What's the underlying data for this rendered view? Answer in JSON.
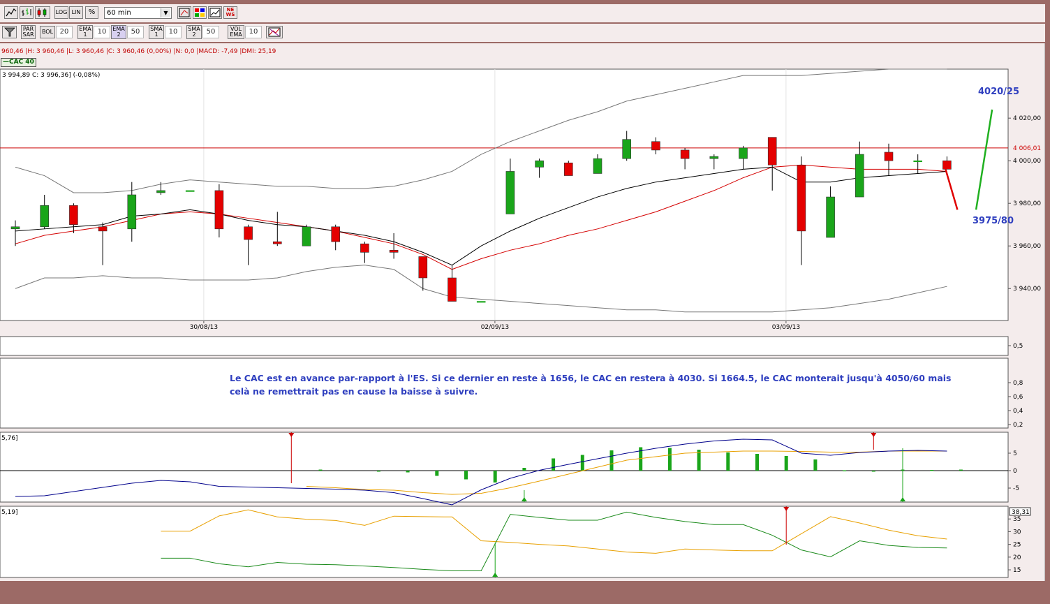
{
  "toolbar1": {
    "items": [
      {
        "name": "line-chart-icon",
        "glyph": "╱"
      },
      {
        "name": "bar-chart-icon",
        "glyph": "┃"
      },
      {
        "name": "candlestick-icon",
        "glyph": "▮"
      },
      {
        "name": "log-button",
        "label": "LOG"
      },
      {
        "name": "lin-button",
        "label": "LIN"
      },
      {
        "name": "percent-button",
        "label": "%"
      }
    ],
    "period_value": "60 min",
    "tool_icons": [
      "draw-tool-icon",
      "color-grid-icon",
      "compare-icon",
      "news-icon"
    ],
    "news_label": "NE WS"
  },
  "toolbar2": {
    "par_sar": "PAR SAR",
    "bol": "BOL",
    "bol_value": "20",
    "ema1": "EMA 1",
    "ema1_value": "10",
    "ema2": "EMA 2",
    "ema2_value": "50",
    "sma1": "SMA 1",
    "sma1_value": "10",
    "sma2": "SMA 2",
    "sma2_value": "50",
    "vol": "VOL EMA",
    "vol_value": "10"
  },
  "info_line": "960,46 |H: 3 960,46 |L: 3 960,46 |C: 3 960,46 (0,00%) |N: 0,0 |MACD: -7,49 |DMI: 25,19",
  "series_tag": "CAC 40",
  "price_line": "3 994,89  C: 3 996,36] (-0,08%)",
  "colors": {
    "bull": "#1aa51a",
    "bear": "#e40000",
    "ema_red": "#d40000",
    "sma_black": "#000000",
    "band": "#777777",
    "annotation": "#2f3fbf",
    "ref_line": "#cc0000",
    "macd": "#00008b",
    "signal": "#e8a000",
    "adx_green": "#1a8a1a",
    "adx_orange": "#e8a000",
    "marker": "#cc0000",
    "up_marker": "#1aa51a"
  },
  "annotation_text": "Le CAC est en avance par-rapport à l'ES. Si ce dernier en reste à 1656, le CAC en restera à 4030.  Si 1664.5, le CAC monterait jusqu'à 4050/60 mais celà ne remettrait pas en cause la baisse à suivre.",
  "chart_data": [
    {
      "type": "candlestick",
      "name": "CAC 40",
      "x_labels": [
        "30/08/13",
        "02/09/13",
        "03/09/13"
      ],
      "x_label_index": [
        7,
        17,
        27
      ],
      "ylim": [
        3925,
        4043
      ],
      "yticks": [
        {
          "v": 4020,
          "label": "4 020,00"
        },
        {
          "v": 4000,
          "label": "4 000,00"
        },
        {
          "v": 3980,
          "label": "3 980,00"
        },
        {
          "v": 3960,
          "label": "3 960,00"
        },
        {
          "v": 3940,
          "label": "3 940,00"
        }
      ],
      "ref_line": {
        "value": 4006.01,
        "label": "4 006,01"
      },
      "candles": [
        {
          "o": 3968,
          "h": 3972,
          "l": 3960,
          "c": 3969
        },
        {
          "o": 3969,
          "h": 3984,
          "l": 3968,
          "c": 3979
        },
        {
          "o": 3979,
          "h": 3980,
          "l": 3966,
          "c": 3970
        },
        {
          "o": 3969,
          "h": 3971,
          "l": 3951,
          "c": 3967
        },
        {
          "o": 3968,
          "h": 3990,
          "l": 3962,
          "c": 3984
        },
        {
          "o": 3985,
          "h": 3990,
          "l": 3984,
          "c": 3986
        },
        {
          "o": 3986,
          "h": 3986,
          "l": 3986,
          "c": 3986
        },
        {
          "o": 3986,
          "h": 3989,
          "l": 3964,
          "c": 3968
        },
        {
          "o": 3969,
          "h": 3970,
          "l": 3951,
          "c": 3963
        },
        {
          "o": 3962,
          "h": 3976,
          "l": 3960,
          "c": 3961
        },
        {
          "o": 3960,
          "h": 3970,
          "l": 3960,
          "c": 3969
        },
        {
          "o": 3969,
          "h": 3970,
          "l": 3958,
          "c": 3962
        },
        {
          "o": 3961,
          "h": 3962,
          "l": 3952,
          "c": 3957
        },
        {
          "o": 3958,
          "h": 3966,
          "l": 3954,
          "c": 3957
        },
        {
          "o": 3955,
          "h": 3955,
          "l": 3939,
          "c": 3945
        },
        {
          "o": 3945,
          "h": 3951,
          "l": 3934,
          "c": 3934
        },
        {
          "o": 3934,
          "h": 3934,
          "l": 3934,
          "c": 3934
        },
        {
          "o": 3975,
          "h": 4001,
          "l": 3975,
          "c": 3995
        },
        {
          "o": 3997,
          "h": 4001,
          "l": 3992,
          "c": 4000
        },
        {
          "o": 3999,
          "h": 4000,
          "l": 3993,
          "c": 3993
        },
        {
          "o": 3994,
          "h": 4003,
          "l": 3994,
          "c": 4001
        },
        {
          "o": 4001,
          "h": 4014,
          "l": 4000,
          "c": 4010
        },
        {
          "o": 4009,
          "h": 4011,
          "l": 4003,
          "c": 4005
        },
        {
          "o": 4005,
          "h": 4006,
          "l": 3996,
          "c": 4001
        },
        {
          "o": 4001,
          "h": 4003,
          "l": 3996,
          "c": 4002
        },
        {
          "o": 4001,
          "h": 4007,
          "l": 3996,
          "c": 4006
        },
        {
          "o": 4011,
          "h": 4011,
          "l": 3986,
          "c": 3998
        },
        {
          "o": 3998,
          "h": 4002,
          "l": 3951,
          "c": 3967
        },
        {
          "o": 3964,
          "h": 3988,
          "l": 3964,
          "c": 3983
        },
        {
          "o": 3983,
          "h": 4009,
          "l": 3983,
          "c": 4003
        },
        {
          "o": 4004,
          "h": 4008,
          "l": 3993,
          "c": 4000
        },
        {
          "o": 4000,
          "h": 4003,
          "l": 3994,
          "c": 4000
        },
        {
          "o": 4000,
          "h": 4002,
          "l": 3996,
          "c": 3996
        }
      ],
      "ema_red": [
        3961,
        3965,
        3967,
        3969,
        3972,
        3975,
        3976,
        3975,
        3973,
        3971,
        3969,
        3967,
        3964,
        3961,
        3956,
        3949,
        3954,
        3958,
        3961,
        3965,
        3968,
        3972,
        3976,
        3981,
        3986,
        3992,
        3997,
        3998,
        3997,
        3996,
        3996,
        3996,
        3995
      ],
      "sma_black": [
        3967,
        3968,
        3969,
        3970,
        3974,
        3975,
        3977,
        3975,
        3972,
        3970,
        3969,
        3967,
        3965,
        3962,
        3957,
        3951,
        3960,
        3967,
        3973,
        3978,
        3983,
        3987,
        3990,
        3992,
        3994,
        3996,
        3997,
        3990,
        3990,
        3992,
        3993,
        3994,
        3995
      ],
      "band_upper": [
        3997,
        3993,
        3985,
        3985,
        3986,
        3989,
        3991,
        3990,
        3989,
        3988,
        3988,
        3987,
        3987,
        3988,
        3991,
        3995,
        4003,
        4009,
        4014,
        4019,
        4023,
        4028,
        4031,
        4034,
        4037,
        4040,
        4040,
        4040,
        4041,
        4042,
        4043,
        4043,
        4043
      ],
      "band_lower": [
        3940,
        3945,
        3945,
        3946,
        3945,
        3945,
        3944,
        3944,
        3944,
        3945,
        3948,
        3950,
        3951,
        3949,
        3940,
        3936,
        3935,
        3934,
        3933,
        3932,
        3931,
        3930,
        3930,
        3929,
        3929,
        3929,
        3929,
        3930,
        3931,
        3933,
        3935,
        3938,
        3941
      ],
      "projection": [
        {
          "index": 32,
          "value": 3996,
          "type": "down",
          "to_value": 3977
        },
        {
          "index": 33,
          "value": 3977,
          "type": "up",
          "to_value": 4024
        }
      ],
      "labels": [
        {
          "text": "4020/25",
          "at": "top-right"
        },
        {
          "text": "3975/80",
          "at": "right"
        }
      ]
    },
    {
      "type": "line",
      "name": "oscillator",
      "ylim": [
        0,
        1
      ],
      "yticks": [
        {
          "v": 0.8,
          "label": "0,8"
        },
        {
          "v": 0.6,
          "label": "0,6"
        },
        {
          "v": 0.4,
          "label": "0,4"
        },
        {
          "v": 0.2,
          "label": "0,2"
        }
      ],
      "top_ticks": [
        {
          "v": 0.5,
          "label": "0,5"
        }
      ]
    },
    {
      "type": "bar",
      "name": "MACD",
      "header": "5,76]",
      "ylim": [
        -10,
        10
      ],
      "yticks": [
        {
          "v": 5,
          "label": "5"
        },
        {
          "v": 0,
          "label": "0"
        },
        {
          "v": -5,
          "label": "-5"
        }
      ],
      "histogram": [
        null,
        null,
        null,
        null,
        null,
        null,
        null,
        null,
        null,
        null,
        0.3,
        null,
        -0.1,
        -0.5,
        -1.5,
        -2.5,
        -3.4,
        0.8,
        3.5,
        4.5,
        5.8,
        6.7,
        6.5,
        6,
        5.2,
        4.8,
        4.2,
        3.2,
        0.1,
        -0.3,
        0.3,
        0.2,
        0.3
      ],
      "macd": [
        -7.4,
        -7.2,
        -6,
        -4.8,
        -3.6,
        -2.8,
        -3.2,
        -4.5,
        -4.7,
        -4.9,
        -5.1,
        -5.3,
        -5.6,
        -6.3,
        -8,
        -9.8,
        -5.5,
        -2.2,
        0.1,
        1.8,
        3.4,
        5,
        6.4,
        7.6,
        8.5,
        9,
        8.8,
        5,
        4.4,
        5.2,
        5.6,
        5.8,
        5.6
      ],
      "signal": [
        null,
        null,
        null,
        null,
        null,
        null,
        null,
        null,
        null,
        null,
        -4.5,
        -4.9,
        -5.4,
        -5.6,
        -6.3,
        -6.8,
        -6.5,
        -4.9,
        -3,
        -1,
        1,
        3,
        4,
        5,
        5.3,
        5.6,
        5.6,
        5.5,
        5.3,
        5.3,
        5.6,
        5.6,
        5.6
      ],
      "markers": [
        {
          "index": 9,
          "type": "down"
        },
        {
          "index": 29,
          "type": "down"
        },
        {
          "index": 17,
          "type": "up"
        },
        {
          "index": 30,
          "type": "up"
        }
      ]
    },
    {
      "type": "line",
      "name": "DMI",
      "header": "5,19]",
      "ylim": [
        12,
        40
      ],
      "yticks": [
        {
          "v": 35,
          "label": "35"
        },
        {
          "v": 30,
          "label": "30"
        },
        {
          "v": 25,
          "label": "25"
        },
        {
          "v": 20,
          "label": "20"
        },
        {
          "v": 15,
          "label": "15"
        }
      ],
      "current_value": "38,31",
      "orange": [
        null,
        null,
        null,
        null,
        null,
        null,
        30.2,
        30.2,
        36.2,
        38.6,
        35.8,
        34.9,
        34.4,
        32.5,
        36.1,
        35.9,
        35.8,
        26.4,
        25.8,
        25,
        24.4,
        23.2,
        22,
        21.5,
        23.2,
        22.8,
        22.5,
        22.5,
        29.2,
        35.9,
        33.4,
        30.6,
        28.4,
        27.1
      ],
      "green": [
        null,
        null,
        null,
        null,
        null,
        null,
        19.6,
        19.6,
        17.4,
        16.2,
        17.9,
        17.2,
        17,
        16.5,
        15.9,
        15.2,
        14.6,
        14.6,
        36.8,
        35.6,
        34.5,
        34.5,
        37.7,
        35.6,
        34,
        32.8,
        32.8,
        28.6,
        22.8,
        20.1,
        26.4,
        24.6,
        23.8,
        23.6
      ],
      "markers": [
        {
          "index": 27,
          "type": "down"
        },
        {
          "index": 17,
          "type": "up"
        }
      ]
    }
  ]
}
